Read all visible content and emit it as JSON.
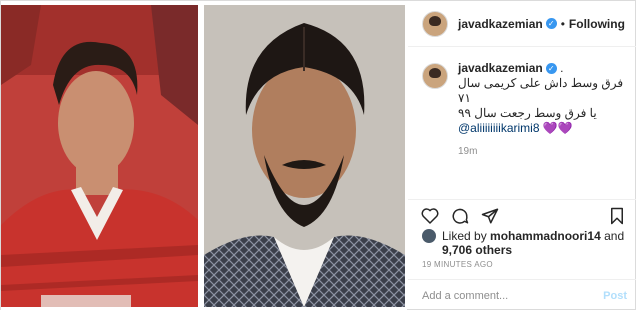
{
  "post": {
    "header": {
      "username": "javadkazemian",
      "verified_icon": "verified-badge-icon",
      "separator": "•",
      "follow_status": "Following"
    },
    "caption": {
      "username": "javadkazemian",
      "verified_icon": "verified-badge-icon",
      "trailing": ".",
      "line1": "فرق وسط داش علی کریمی سال ۷۱",
      "line2": "یا فرق وسط رجعت سال ۹۹",
      "mention": "@aliiiiiiiikarimi8",
      "hearts": "💜💜",
      "time": "19m"
    },
    "actions": {
      "like_icon": "heart-icon",
      "comment_icon": "comment-bubble-icon",
      "share_icon": "paper-plane-icon",
      "save_icon": "bookmark-icon"
    },
    "likes": {
      "prefix": "Liked by",
      "user": "mohammadnoori14",
      "joiner": "and",
      "others": "9,706 others"
    },
    "posted_ago": "19 MINUTES AGO",
    "comment": {
      "placeholder": "Add a comment...",
      "post_label": "Post"
    },
    "colors": {
      "border": "#dbdbdb",
      "verified": "#3897f0",
      "post_button_disabled": "#b2dffc",
      "mention": "#00376b"
    }
  }
}
